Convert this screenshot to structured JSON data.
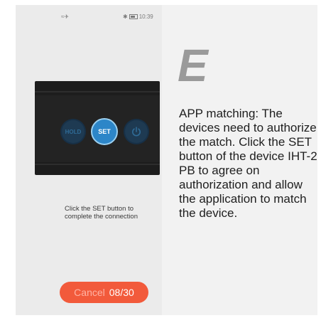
{
  "status_bar": {
    "left_icons": "≈✈",
    "right_icons": "✱",
    "time": "10:39"
  },
  "device": {
    "hold_label": "HOLD",
    "set_label": "SET",
    "power_icon": "power-icon"
  },
  "instruction": "Click the SET button to complete the connection",
  "cancel_button": {
    "label": "Cancel",
    "counter": "08/30"
  },
  "step": {
    "letter": "E",
    "description": "APP matching: The devices need to authorize the match. Click the SET button of the device IHT-2 PB to agree on authorization and allow the application to match the device."
  },
  "colors": {
    "accent": "#f25a3b",
    "set_button": "#2d86c8"
  }
}
